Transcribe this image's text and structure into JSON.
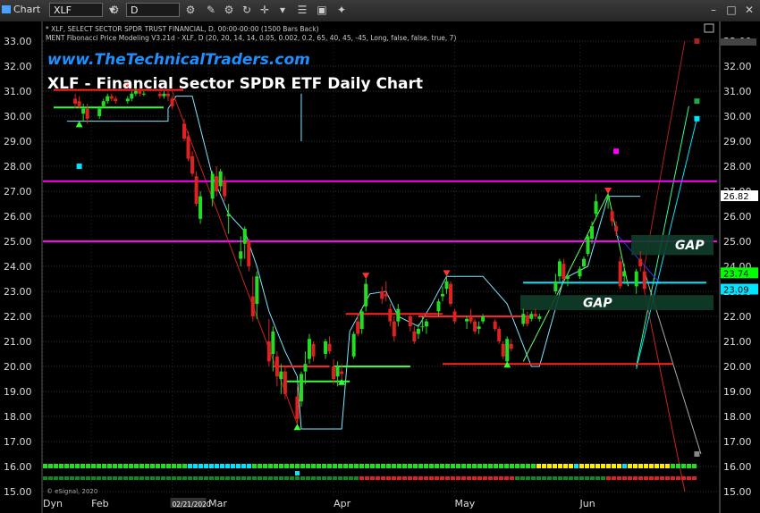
{
  "toolbar": {
    "app_label": "Chart",
    "symbol_value": "XLF",
    "interval_value": "D"
  },
  "header": {
    "info_line1": "* XLF, SELECT SECTOR SPDR TRUST FINANCIAL, D, 00:00-00:00 (1500 Bars Back)",
    "info_line2": "MENT Fibonacci Price Modeling V3.21d - XLF, D (20, 20, 14, 14, 0.05, 0.002, 0.2, 65, 40, 45, -45, Long, false, false, true, 7)",
    "website": "www.TheTechnicalTraders.com",
    "chart_title": "XLF - Financial Sector SPDR ETF Daily Chart",
    "copyright": "© eSignal, 2020"
  },
  "chart_data": {
    "type": "candlestick",
    "title": "XLF - Financial Sector SPDR ETF Daily Chart",
    "ylim": [
      15,
      33
    ],
    "y_ticks": [
      "33.00",
      "32.00",
      "31.00",
      "30.00",
      "29.00",
      "28.00",
      "27.00",
      "26.00",
      "25.00",
      "24.00",
      "23.00",
      "22.00",
      "21.00",
      "20.00",
      "19.00",
      "18.00",
      "17.00",
      "16.00",
      "15.00"
    ],
    "x_labels": [
      {
        "label": "Dyn",
        "date": "2020-01-20"
      },
      {
        "label": "Feb",
        "date": "2020-02-01"
      },
      {
        "label": "02/21/2020",
        "date": "2020-02-21"
      },
      {
        "label": "Mar",
        "date": "2020-03-01"
      },
      {
        "label": "Apr",
        "date": "2020-04-01"
      },
      {
        "label": "May",
        "date": "2020-05-01"
      },
      {
        "label": "Jun",
        "date": "2020-06-01"
      }
    ],
    "price_badges": [
      {
        "label": "26.82",
        "value": 26.82,
        "color": "#ffffff"
      },
      {
        "label": "23.74",
        "value": 23.74,
        "color": "#00ff00"
      },
      {
        "label": "23.09",
        "value": 23.09,
        "color": "#00e5ff"
      }
    ],
    "gap_labels": [
      {
        "label": "GAP",
        "low": 24.45,
        "high": 25.25
      },
      {
        "label": "GAP",
        "low": 22.25,
        "high": 22.85
      }
    ],
    "horizontal_levels": [
      {
        "value": 27.4,
        "color": "#ff00ff"
      },
      {
        "value": 25.0,
        "color": "#ff00ff"
      },
      {
        "value": 31.05,
        "color": "#ff2222"
      },
      {
        "value": 30.35,
        "color": "#33ff33"
      },
      {
        "value": 23.35,
        "color": "#00e5ff"
      }
    ],
    "candles": [
      {
        "date": "2020-01-28",
        "o": 30.7,
        "h": 30.9,
        "l": 30.3,
        "c": 30.5
      },
      {
        "date": "2020-01-29",
        "o": 30.6,
        "h": 30.8,
        "l": 30.3,
        "c": 30.4
      },
      {
        "date": "2020-01-30",
        "o": 30.1,
        "h": 30.5,
        "l": 29.8,
        "c": 30.3
      },
      {
        "date": "2020-01-31",
        "o": 30.3,
        "h": 30.5,
        "l": 29.7,
        "c": 29.9
      },
      {
        "date": "2020-02-03",
        "o": 30.0,
        "h": 30.4,
        "l": 29.9,
        "c": 30.3
      },
      {
        "date": "2020-02-04",
        "o": 30.4,
        "h": 30.7,
        "l": 30.3,
        "c": 30.6
      },
      {
        "date": "2020-02-05",
        "o": 30.6,
        "h": 30.9,
        "l": 30.5,
        "c": 30.8
      },
      {
        "date": "2020-02-06",
        "o": 30.8,
        "h": 30.9,
        "l": 30.6,
        "c": 30.7
      },
      {
        "date": "2020-02-07",
        "o": 30.7,
        "h": 30.8,
        "l": 30.5,
        "c": 30.6
      },
      {
        "date": "2020-02-10",
        "o": 30.6,
        "h": 30.8,
        "l": 30.5,
        "c": 30.7
      },
      {
        "date": "2020-02-11",
        "o": 30.7,
        "h": 31.0,
        "l": 30.6,
        "c": 30.9
      },
      {
        "date": "2020-02-12",
        "o": 30.9,
        "h": 31.1,
        "l": 30.8,
        "c": 31.0
      },
      {
        "date": "2020-02-13",
        "o": 31.0,
        "h": 31.1,
        "l": 30.8,
        "c": 30.9
      },
      {
        "date": "2020-02-14",
        "o": 30.9,
        "h": 31.0,
        "l": 30.8,
        "c": 30.9
      },
      {
        "date": "2020-02-18",
        "o": 30.9,
        "h": 31.0,
        "l": 30.7,
        "c": 30.8
      },
      {
        "date": "2020-02-19",
        "o": 30.8,
        "h": 31.0,
        "l": 30.7,
        "c": 30.9
      },
      {
        "date": "2020-02-20",
        "o": 30.9,
        "h": 31.0,
        "l": 30.6,
        "c": 30.8
      },
      {
        "date": "2020-02-21",
        "o": 30.7,
        "h": 30.8,
        "l": 30.3,
        "c": 30.4
      },
      {
        "date": "2020-02-24",
        "o": 29.7,
        "h": 29.9,
        "l": 29.0,
        "c": 29.1
      },
      {
        "date": "2020-02-25",
        "o": 29.2,
        "h": 29.4,
        "l": 28.2,
        "c": 28.3
      },
      {
        "date": "2020-02-26",
        "o": 28.4,
        "h": 28.6,
        "l": 27.6,
        "c": 27.7
      },
      {
        "date": "2020-02-27",
        "o": 27.6,
        "h": 27.8,
        "l": 26.4,
        "c": 26.5
      },
      {
        "date": "2020-02-28",
        "o": 25.9,
        "h": 27.0,
        "l": 25.7,
        "c": 26.8
      },
      {
        "date": "2020-03-02",
        "o": 26.7,
        "h": 27.8,
        "l": 26.4,
        "c": 27.7
      },
      {
        "date": "2020-03-03",
        "o": 27.6,
        "h": 28.0,
        "l": 26.8,
        "c": 27.0
      },
      {
        "date": "2020-03-04",
        "o": 27.2,
        "h": 27.9,
        "l": 27.0,
        "c": 27.8
      },
      {
        "date": "2020-03-05",
        "o": 27.4,
        "h": 27.6,
        "l": 26.6,
        "c": 26.8
      },
      {
        "date": "2020-03-06",
        "o": 26.0,
        "h": 26.5,
        "l": 25.3,
        "c": 26.1
      },
      {
        "date": "2020-03-09",
        "o": 24.3,
        "h": 25.2,
        "l": 24.0,
        "c": 24.6
      },
      {
        "date": "2020-03-10",
        "o": 24.9,
        "h": 25.6,
        "l": 24.3,
        "c": 25.5
      },
      {
        "date": "2020-03-11",
        "o": 25.0,
        "h": 25.1,
        "l": 23.8,
        "c": 24.0
      },
      {
        "date": "2020-03-12",
        "o": 22.8,
        "h": 23.6,
        "l": 21.8,
        "c": 22.0
      },
      {
        "date": "2020-03-13",
        "o": 22.5,
        "h": 23.8,
        "l": 21.9,
        "c": 23.6
      },
      {
        "date": "2020-03-16",
        "o": 21.0,
        "h": 21.9,
        "l": 20.0,
        "c": 20.2
      },
      {
        "date": "2020-03-17",
        "o": 20.5,
        "h": 21.6,
        "l": 19.8,
        "c": 21.4
      },
      {
        "date": "2020-03-18",
        "o": 20.4,
        "h": 20.6,
        "l": 19.2,
        "c": 19.6
      },
      {
        "date": "2020-03-19",
        "o": 19.5,
        "h": 20.1,
        "l": 18.9,
        "c": 19.8
      },
      {
        "date": "2020-03-20",
        "o": 19.8,
        "h": 20.0,
        "l": 18.7,
        "c": 18.9
      },
      {
        "date": "2020-03-23",
        "o": 18.8,
        "h": 19.2,
        "l": 17.7,
        "c": 17.9
      },
      {
        "date": "2020-03-24",
        "o": 18.6,
        "h": 19.8,
        "l": 18.4,
        "c": 19.7
      },
      {
        "date": "2020-03-25",
        "o": 19.8,
        "h": 20.6,
        "l": 19.3,
        "c": 20.1
      },
      {
        "date": "2020-03-26",
        "o": 20.3,
        "h": 21.3,
        "l": 20.1,
        "c": 21.1
      },
      {
        "date": "2020-03-27",
        "o": 20.9,
        "h": 21.0,
        "l": 20.2,
        "c": 20.4
      },
      {
        "date": "2020-03-30",
        "o": 20.5,
        "h": 21.1,
        "l": 20.3,
        "c": 21.0
      },
      {
        "date": "2020-03-31",
        "o": 20.9,
        "h": 21.2,
        "l": 20.5,
        "c": 20.6
      },
      {
        "date": "2020-04-01",
        "o": 20.0,
        "h": 20.3,
        "l": 19.3,
        "c": 19.5
      },
      {
        "date": "2020-04-02",
        "o": 19.6,
        "h": 20.2,
        "l": 19.2,
        "c": 20.0
      },
      {
        "date": "2020-04-03",
        "o": 19.8,
        "h": 20.1,
        "l": 19.5,
        "c": 19.7
      },
      {
        "date": "2020-04-06",
        "o": 20.4,
        "h": 21.4,
        "l": 20.3,
        "c": 21.3
      },
      {
        "date": "2020-04-07",
        "o": 21.8,
        "h": 22.1,
        "l": 21.2,
        "c": 21.3
      },
      {
        "date": "2020-04-08",
        "o": 21.5,
        "h": 22.3,
        "l": 21.3,
        "c": 22.2
      },
      {
        "date": "2020-04-09",
        "o": 22.4,
        "h": 23.5,
        "l": 22.2,
        "c": 23.3
      },
      {
        "date": "2020-04-13",
        "o": 23.0,
        "h": 23.2,
        "l": 22.5,
        "c": 22.7
      },
      {
        "date": "2020-04-14",
        "o": 22.9,
        "h": 23.4,
        "l": 22.6,
        "c": 22.8
      },
      {
        "date": "2020-04-15",
        "o": 22.3,
        "h": 22.5,
        "l": 21.6,
        "c": 21.8
      },
      {
        "date": "2020-04-16",
        "o": 21.8,
        "h": 22.0,
        "l": 21.0,
        "c": 21.2
      },
      {
        "date": "2020-04-17",
        "o": 21.8,
        "h": 22.5,
        "l": 21.6,
        "c": 22.3
      },
      {
        "date": "2020-04-20",
        "o": 22.0,
        "h": 22.1,
        "l": 21.4,
        "c": 21.6
      },
      {
        "date": "2020-04-21",
        "o": 21.4,
        "h": 21.6,
        "l": 20.9,
        "c": 21.0
      },
      {
        "date": "2020-04-22",
        "o": 21.3,
        "h": 21.7,
        "l": 21.1,
        "c": 21.5
      },
      {
        "date": "2020-04-23",
        "o": 21.6,
        "h": 22.0,
        "l": 21.4,
        "c": 21.6
      },
      {
        "date": "2020-04-24",
        "o": 21.6,
        "h": 21.9,
        "l": 21.3,
        "c": 21.8
      },
      {
        "date": "2020-04-27",
        "o": 22.2,
        "h": 22.7,
        "l": 22.0,
        "c": 22.6
      },
      {
        "date": "2020-04-28",
        "o": 22.8,
        "h": 23.2,
        "l": 22.6,
        "c": 22.9
      },
      {
        "date": "2020-04-29",
        "o": 23.1,
        "h": 23.6,
        "l": 22.9,
        "c": 23.4
      },
      {
        "date": "2020-04-30",
        "o": 23.3,
        "h": 23.4,
        "l": 22.4,
        "c": 22.5
      },
      {
        "date": "2020-05-01",
        "o": 22.2,
        "h": 22.3,
        "l": 21.7,
        "c": 21.8
      },
      {
        "date": "2020-05-04",
        "o": 21.8,
        "h": 22.0,
        "l": 21.5,
        "c": 21.9
      },
      {
        "date": "2020-05-05",
        "o": 22.0,
        "h": 22.3,
        "l": 21.7,
        "c": 21.8
      },
      {
        "date": "2020-05-06",
        "o": 21.8,
        "h": 21.9,
        "l": 21.3,
        "c": 21.4
      },
      {
        "date": "2020-05-07",
        "o": 21.5,
        "h": 21.8,
        "l": 21.3,
        "c": 21.6
      },
      {
        "date": "2020-05-08",
        "o": 21.8,
        "h": 22.1,
        "l": 21.7,
        "c": 22.0
      },
      {
        "date": "2020-05-11",
        "o": 21.8,
        "h": 21.9,
        "l": 21.4,
        "c": 21.5
      },
      {
        "date": "2020-05-12",
        "o": 21.5,
        "h": 21.6,
        "l": 20.9,
        "c": 21.0
      },
      {
        "date": "2020-05-13",
        "o": 20.9,
        "h": 21.0,
        "l": 20.3,
        "c": 20.4
      },
      {
        "date": "2020-05-14",
        "o": 20.2,
        "h": 21.2,
        "l": 20.1,
        "c": 21.1
      },
      {
        "date": "2020-05-15",
        "o": 20.9,
        "h": 21.1,
        "l": 20.6,
        "c": 20.7
      },
      {
        "date": "2020-05-18",
        "o": 21.7,
        "h": 22.3,
        "l": 21.6,
        "c": 22.1
      },
      {
        "date": "2020-05-19",
        "o": 22.0,
        "h": 22.2,
        "l": 21.6,
        "c": 21.7
      },
      {
        "date": "2020-05-20",
        "o": 21.9,
        "h": 22.2,
        "l": 21.8,
        "c": 22.1
      },
      {
        "date": "2020-05-21",
        "o": 22.1,
        "h": 22.3,
        "l": 21.9,
        "c": 22.0
      },
      {
        "date": "2020-05-22",
        "o": 21.9,
        "h": 22.1,
        "l": 21.8,
        "c": 22.0
      },
      {
        "date": "2020-05-26",
        "o": 23.0,
        "h": 23.7,
        "l": 22.9,
        "c": 23.4
      },
      {
        "date": "2020-05-27",
        "o": 23.6,
        "h": 24.3,
        "l": 23.4,
        "c": 24.2
      },
      {
        "date": "2020-05-28",
        "o": 24.1,
        "h": 24.3,
        "l": 23.4,
        "c": 23.5
      },
      {
        "date": "2020-05-29",
        "o": 23.5,
        "h": 23.7,
        "l": 23.2,
        "c": 23.6
      },
      {
        "date": "2020-06-01",
        "o": 23.6,
        "h": 24.0,
        "l": 23.5,
        "c": 23.9
      },
      {
        "date": "2020-06-02",
        "o": 24.0,
        "h": 24.4,
        "l": 23.9,
        "c": 24.3
      },
      {
        "date": "2020-06-03",
        "o": 24.5,
        "h": 25.3,
        "l": 24.4,
        "c": 25.2
      },
      {
        "date": "2020-06-04",
        "o": 25.1,
        "h": 25.8,
        "l": 24.9,
        "c": 25.6
      },
      {
        "date": "2020-06-05",
        "o": 26.1,
        "h": 26.9,
        "l": 25.9,
        "c": 26.6
      },
      {
        "date": "2020-06-08",
        "o": 26.7,
        "h": 26.9,
        "l": 26.3,
        "c": 26.8
      },
      {
        "date": "2020-06-09",
        "o": 26.2,
        "h": 26.3,
        "l": 25.6,
        "c": 25.8
      },
      {
        "date": "2020-06-10",
        "o": 25.6,
        "h": 25.8,
        "l": 25.2,
        "c": 25.4
      },
      {
        "date": "2020-06-11",
        "o": 24.2,
        "h": 24.4,
        "l": 23.1,
        "c": 23.2
      },
      {
        "date": "2020-06-12",
        "o": 23.6,
        "h": 24.1,
        "l": 23.3,
        "c": 23.8
      },
      {
        "date": "2020-06-15",
        "o": 23.2,
        "h": 23.9,
        "l": 22.9,
        "c": 23.8
      },
      {
        "date": "2020-06-16",
        "o": 24.3,
        "h": 24.6,
        "l": 23.8,
        "c": 24.0
      },
      {
        "date": "2020-06-17",
        "o": 23.8,
        "h": 24.0,
        "l": 23.0,
        "c": 23.1
      }
    ]
  }
}
